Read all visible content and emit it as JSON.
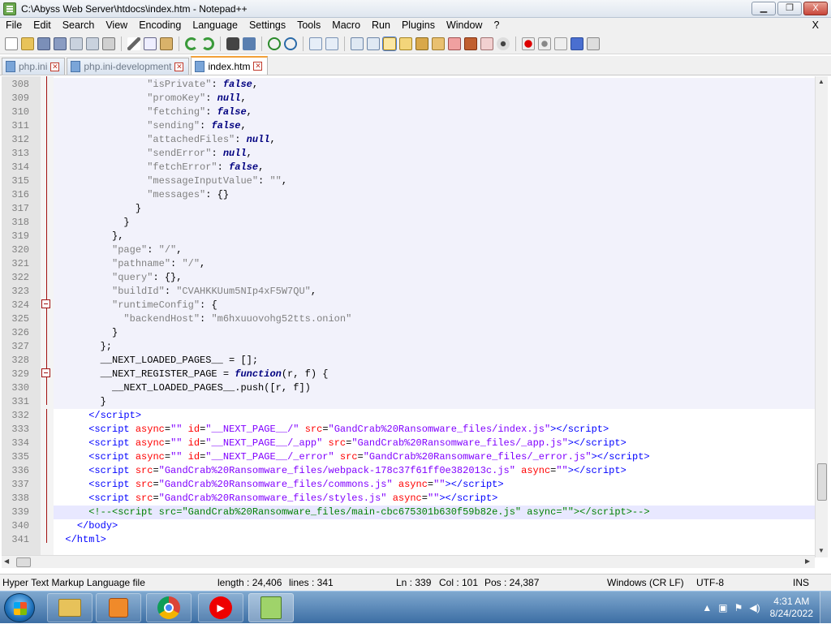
{
  "window": {
    "title": "C:\\Abyss Web Server\\htdocs\\index.htm - Notepad++",
    "minimize_label": "▁",
    "maximize_label": "❐",
    "close_label": "X"
  },
  "menu": [
    "File",
    "Edit",
    "Search",
    "View",
    "Encoding",
    "Language",
    "Settings",
    "Tools",
    "Macro",
    "Run",
    "Plugins",
    "Window",
    "?"
  ],
  "menu_close": "X",
  "tabs": [
    {
      "label": "php.ini",
      "active": false
    },
    {
      "label": "php.ini-development",
      "active": false
    },
    {
      "label": "index.htm",
      "active": true
    }
  ],
  "editor": {
    "lines": [
      {
        "n": "308",
        "html": "                <span class='s'>\"isPrivate\"</span>: <span class='kw'>false</span>,"
      },
      {
        "n": "309",
        "html": "                <span class='s'>\"promoKey\"</span>: <span class='kw'>null</span>,"
      },
      {
        "n": "310",
        "html": "                <span class='s'>\"fetching\"</span>: <span class='kw'>false</span>,"
      },
      {
        "n": "311",
        "html": "                <span class='s'>\"sending\"</span>: <span class='kw'>false</span>,"
      },
      {
        "n": "312",
        "html": "                <span class='s'>\"attachedFiles\"</span>: <span class='kw'>null</span>,"
      },
      {
        "n": "313",
        "html": "                <span class='s'>\"sendError\"</span>: <span class='kw'>null</span>,"
      },
      {
        "n": "314",
        "html": "                <span class='s'>\"fetchError\"</span>: <span class='kw'>false</span>,"
      },
      {
        "n": "315",
        "html": "                <span class='s'>\"messageInputValue\"</span>: <span class='s'>\"\"</span>,"
      },
      {
        "n": "316",
        "html": "                <span class='s'>\"messages\"</span>: {}"
      },
      {
        "n": "317",
        "html": "              }"
      },
      {
        "n": "318",
        "html": "            }"
      },
      {
        "n": "319",
        "html": "          },"
      },
      {
        "n": "320",
        "html": "          <span class='s'>\"page\"</span>: <span class='s'>\"/\"</span>,"
      },
      {
        "n": "321",
        "html": "          <span class='s'>\"pathname\"</span>: <span class='s'>\"/\"</span>,"
      },
      {
        "n": "322",
        "html": "          <span class='s'>\"query\"</span>: {},"
      },
      {
        "n": "323",
        "html": "          <span class='s'>\"buildId\"</span>: <span class='s'>\"CVAHKKUum5NIp4xF5W7QU\"</span>,"
      },
      {
        "n": "324",
        "html": "          <span class='s'>\"runtimeConfig\"</span>: {"
      },
      {
        "n": "325",
        "html": "            <span class='s'>\"backendHost\"</span>: <span class='s'>\"m6hxuuovohg52tts.onion\"</span>"
      },
      {
        "n": "326",
        "html": "          }"
      },
      {
        "n": "327",
        "html": "        };"
      },
      {
        "n": "328",
        "html": "        __NEXT_LOADED_PAGES__ = [];"
      },
      {
        "n": "329",
        "html": "        __NEXT_REGISTER_PAGE = <span class='kw'>function</span>(r, f) {"
      },
      {
        "n": "330",
        "html": "          __NEXT_LOADED_PAGES__.push([r, f])"
      },
      {
        "n": "331",
        "html": "        }"
      },
      {
        "n": "332",
        "html": "      <span class='tag'>&lt;/script&gt;</span>"
      },
      {
        "n": "333",
        "html": "      <span class='tag'>&lt;script</span> <span class='at'>async</span>=<span class='av'>\"\"</span> <span class='at'>id</span>=<span class='av'>\"__NEXT_PAGE__/\"</span> <span class='at'>src</span>=<span class='av'>\"GandCrab%20Ransomware_files/index.js\"</span><span class='tag'>&gt;&lt;/script&gt;</span>"
      },
      {
        "n": "334",
        "html": "      <span class='tag'>&lt;script</span> <span class='at'>async</span>=<span class='av'>\"\"</span> <span class='at'>id</span>=<span class='av'>\"__NEXT_PAGE__/_app\"</span> <span class='at'>src</span>=<span class='av'>\"GandCrab%20Ransomware_files/_app.js\"</span><span class='tag'>&gt;&lt;/script&gt;</span>"
      },
      {
        "n": "335",
        "html": "      <span class='tag'>&lt;script</span> <span class='at'>async</span>=<span class='av'>\"\"</span> <span class='at'>id</span>=<span class='av'>\"__NEXT_PAGE__/_error\"</span> <span class='at'>src</span>=<span class='av'>\"GandCrab%20Ransomware_files/_error.js\"</span><span class='tag'>&gt;&lt;/script&gt;</span>"
      },
      {
        "n": "336",
        "html": "      <span class='tag'>&lt;script</span> <span class='at'>src</span>=<span class='av'>\"GandCrab%20Ransomware_files/webpack-178c37f61ff0e382013c.js\"</span> <span class='at'>async</span>=<span class='av'>\"\"</span><span class='tag'>&gt;&lt;/script&gt;</span>"
      },
      {
        "n": "337",
        "html": "      <span class='tag'>&lt;script</span> <span class='at'>src</span>=<span class='av'>\"GandCrab%20Ransomware_files/commons.js\"</span> <span class='at'>async</span>=<span class='av'>\"\"</span><span class='tag'>&gt;&lt;/script&gt;</span>"
      },
      {
        "n": "338",
        "html": "      <span class='tag'>&lt;script</span> <span class='at'>src</span>=<span class='av'>\"GandCrab%20Ransomware_files/styles.js\"</span> <span class='at'>async</span>=<span class='av'>\"\"</span><span class='tag'>&gt;&lt;/script&gt;</span>"
      },
      {
        "n": "339",
        "html": "      <span class='cm'>&lt;!--&lt;script src=\"GandCrab%20Ransomware_files/main-cbc675301b630f59b82e.js\" async=\"\"&gt;&lt;/script&gt;--&gt;</span>"
      },
      {
        "n": "340",
        "html": "    <span class='tag'>&lt;/body&gt;</span>"
      },
      {
        "n": "341",
        "html": "  <span class='tag'>&lt;/html&gt;</span>"
      }
    ]
  },
  "status": {
    "filetype": "Hyper Text Markup Language file",
    "length": "length : 24,406",
    "lines": "lines : 341",
    "ln": "Ln : 339",
    "col": "Col : 101",
    "pos": "Pos : 24,387",
    "eol": "Windows (CR LF)",
    "encoding": "UTF-8",
    "mode": "INS"
  },
  "taskbar": {
    "time": "4:31 AM",
    "date": "8/24/2022"
  }
}
